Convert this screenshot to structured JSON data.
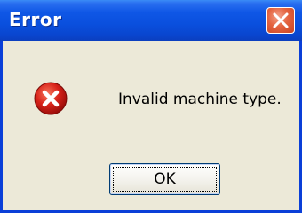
{
  "window": {
    "title": "Error"
  },
  "dialog": {
    "message": "Invalid machine type.",
    "icon": "error-icon",
    "ok_label": "OK"
  },
  "colors": {
    "title_bar": "#0a4fdd",
    "client_bg": "#ece9d8",
    "close_button": "#e4633f",
    "error_icon": "#d8231a"
  }
}
